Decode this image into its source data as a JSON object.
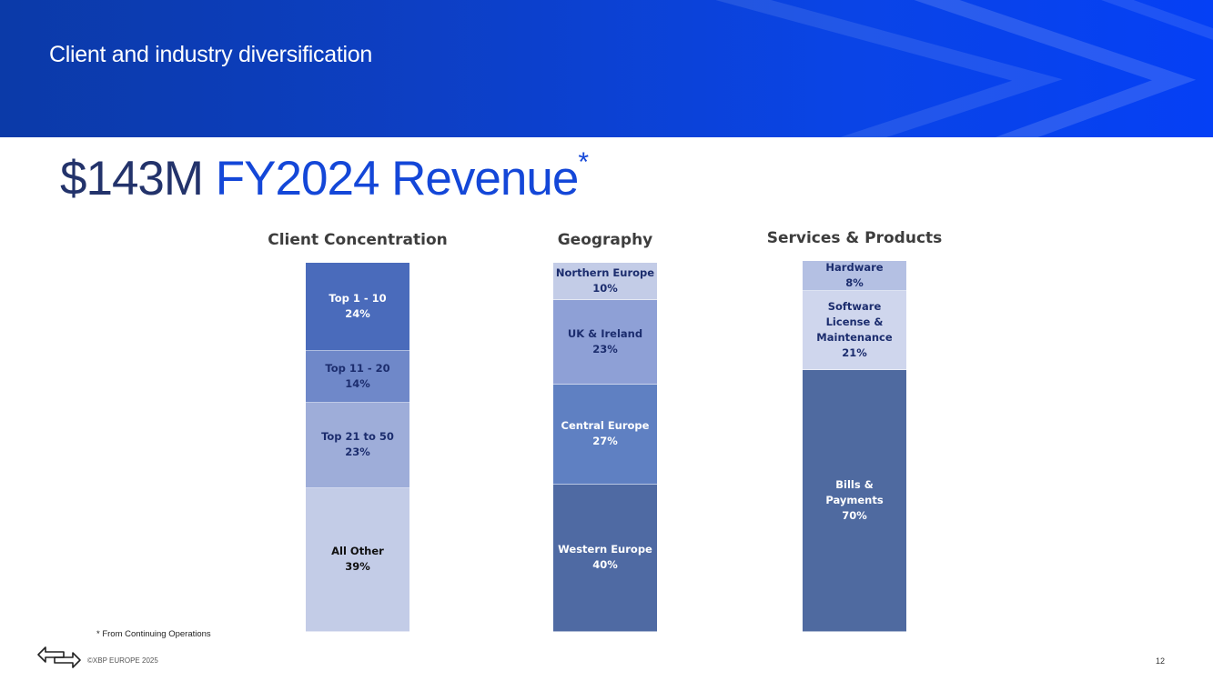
{
  "header": {
    "title": "Client and industry diversification"
  },
  "headline": {
    "amount": "$143M",
    "label": "FY2024 Revenue",
    "marker": "*"
  },
  "chart_data": [
    {
      "type": "bar",
      "stacked": true,
      "title": "Client Concentration",
      "unit": "%",
      "segments": [
        {
          "label": "Top 1 - 10",
          "value": 24,
          "value_label": "24%",
          "color": "#4a6bbb",
          "text_color": "#ffffff"
        },
        {
          "label": "Top 11 - 20",
          "value": 14,
          "value_label": "14%",
          "color": "#6f88c9",
          "text_color": "#1c2d6e"
        },
        {
          "label": "Top 21 to 50",
          "value": 23,
          "value_label": "23%",
          "color": "#9eadd9",
          "text_color": "#1c2d6e"
        },
        {
          "label": "All Other",
          "value": 39,
          "value_label": "39%",
          "color": "#c3cce7",
          "text_color": "#111111"
        }
      ]
    },
    {
      "type": "bar",
      "stacked": true,
      "title": "Geography",
      "unit": "%",
      "segments": [
        {
          "label": "Northern Europe",
          "value": 10,
          "value_label": "10%",
          "color": "#c3cce7",
          "text_color": "#1c2d6e"
        },
        {
          "label": "UK & Ireland",
          "value": 23,
          "value_label": "23%",
          "color": "#8ea0d6",
          "text_color": "#1c2d6e"
        },
        {
          "label": "Central Europe",
          "value": 27,
          "value_label": "27%",
          "color": "#5f80c2",
          "text_color": "#ffffff"
        },
        {
          "label": "Western Europe",
          "value": 40,
          "value_label": "40%",
          "color": "#4f6aa3",
          "text_color": "#ffffff"
        }
      ]
    },
    {
      "type": "bar",
      "stacked": true,
      "title": "Services & Products",
      "unit": "%",
      "segments": [
        {
          "label": "Hardware",
          "value": 8,
          "value_label": "8%",
          "color": "#b4c0e3",
          "text_color": "#1c2d6e"
        },
        {
          "label": "Software\nLicense &\nMaintenance",
          "value": 21,
          "value_label": "21%",
          "color": "#cfd6ed",
          "text_color": "#1c2d6e"
        },
        {
          "label": "Bills &\nPayments",
          "value": 70,
          "value_label": "70%",
          "color": "#4f6aa0",
          "text_color": "#ffffff"
        }
      ]
    }
  ],
  "footer": {
    "footnote": "* From Continuing Operations",
    "copyright": "©XBP EUROPE 2025",
    "page_number": "12"
  }
}
